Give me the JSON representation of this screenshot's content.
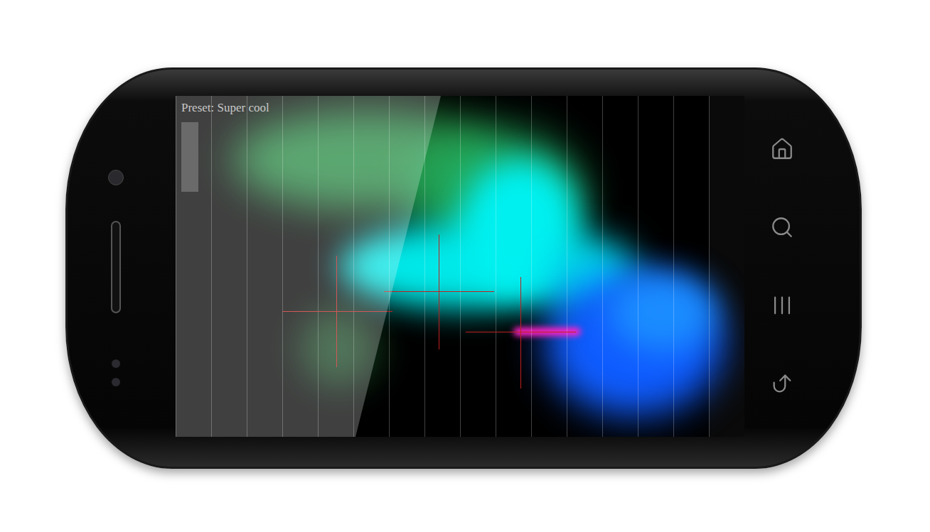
{
  "screen": {
    "preset": "Preset: Super cool",
    "meter": {
      "level": 1
    }
  }
}
